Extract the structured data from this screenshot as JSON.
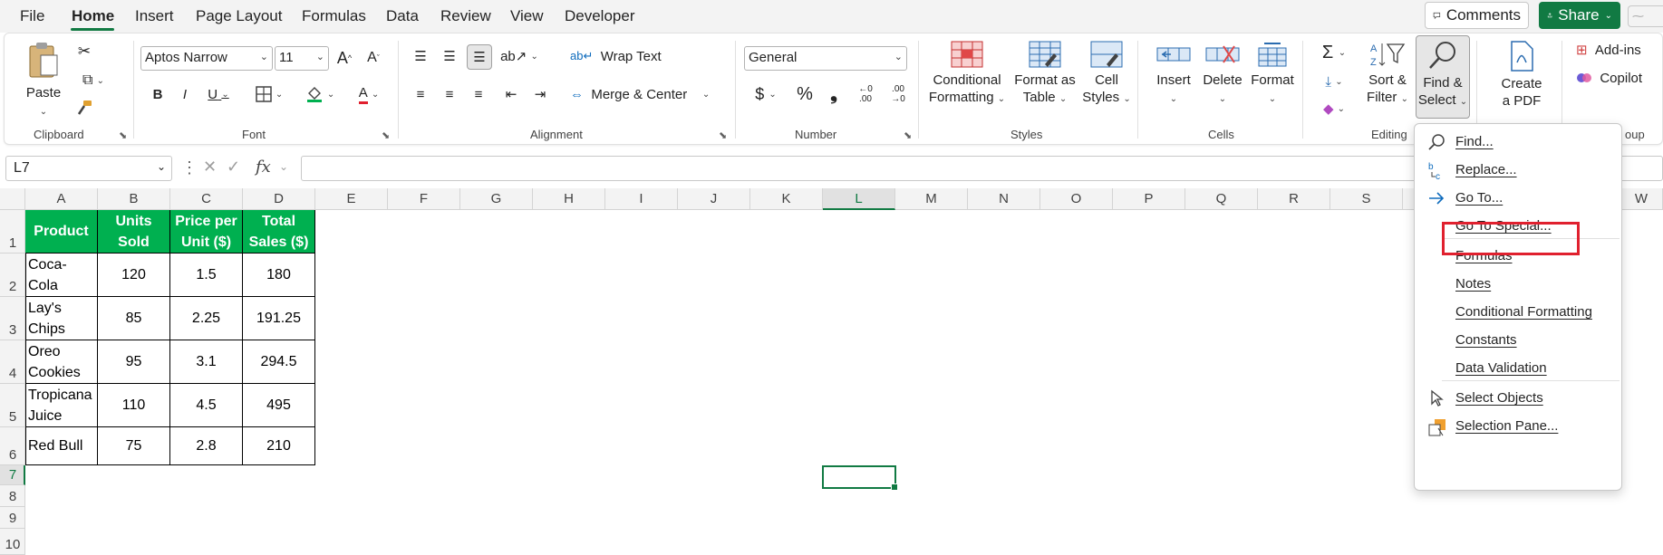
{
  "menu": {
    "tabs": [
      "File",
      "Home",
      "Insert",
      "Page Layout",
      "Formulas",
      "Data",
      "Review",
      "View",
      "Developer"
    ],
    "active_tab": "Home",
    "comments_label": "Comments",
    "share_label": "Share"
  },
  "ribbon": {
    "clipboard": {
      "paste_label": "Paste",
      "group_label": "Clipboard"
    },
    "font": {
      "font_name": "Aptos Narrow",
      "font_size": "11",
      "bold": "B",
      "italic": "I",
      "underline": "U",
      "grow": "A",
      "shrink": "A",
      "font_color_letter": "A",
      "group_label": "Font"
    },
    "alignment": {
      "wrap_text": "Wrap Text",
      "merge_center": "Merge & Center",
      "group_label": "Alignment"
    },
    "number": {
      "format": "General",
      "currency": "$",
      "percent": "%",
      "comma": "❟",
      "inc_decimal": "←0 .00",
      "dec_decimal": ".00 →0",
      "group_label": "Number"
    },
    "styles": {
      "conditional_formatting": [
        "Conditional",
        "Formatting"
      ],
      "format_as_table": [
        "Format as",
        "Table"
      ],
      "cell_styles": [
        "Cell",
        "Styles"
      ],
      "group_label": "Styles"
    },
    "cells": {
      "insert": "Insert",
      "delete": "Delete",
      "format": "Format",
      "group_label": "Cells"
    },
    "editing": {
      "sort_filter": [
        "Sort &",
        "Filter"
      ],
      "find_select": [
        "Find &",
        "Select"
      ],
      "group_label": "Editing"
    },
    "pdf": {
      "create_pdf": [
        "Create",
        "a PDF"
      ]
    },
    "addins": {
      "addins_label": "Add-ins",
      "copilot_label": "Copilot",
      "group_label_partial": "oup"
    }
  },
  "formula_bar": {
    "name_box": "L7",
    "fx": "fx",
    "formula": ""
  },
  "grid": {
    "columns": [
      "A",
      "B",
      "C",
      "D",
      "E",
      "F",
      "G",
      "H",
      "I",
      "J",
      "K",
      "L",
      "M",
      "N",
      "O",
      "P",
      "Q",
      "R",
      "S",
      "T",
      "W"
    ],
    "selected_column": "L",
    "rows": [
      "1",
      "2",
      "3",
      "4",
      "5",
      "6",
      "7",
      "8",
      "9",
      "10"
    ],
    "selected_row": "7"
  },
  "table": {
    "headers": [
      [
        "Product"
      ],
      [
        "Units",
        "Sold"
      ],
      [
        "Price per",
        "Unit ($)"
      ],
      [
        "Total",
        "Sales ($)"
      ]
    ],
    "rows": [
      [
        [
          "Coca-",
          "Cola"
        ],
        "120",
        "1.5",
        "180"
      ],
      [
        [
          "Lay's",
          "Chips"
        ],
        "85",
        "2.25",
        "191.25"
      ],
      [
        [
          "Oreo",
          "Cookies"
        ],
        "95",
        "3.1",
        "294.5"
      ],
      [
        [
          "Tropicana",
          "Juice"
        ],
        "110",
        "4.5",
        "495"
      ],
      [
        [
          "Red Bull"
        ],
        "75",
        "2.8",
        "210"
      ]
    ],
    "header_color": "#00b050"
  },
  "dropdown": {
    "items": [
      {
        "label": "Find...",
        "icon": "search-icon"
      },
      {
        "label": "Replace...",
        "icon": "replace-icon"
      },
      {
        "label": "Go To...",
        "icon": "arrow-right-icon"
      },
      {
        "label": "Go To Special...",
        "icon": "",
        "highlighted": true
      },
      {
        "label": "Formulas",
        "icon": ""
      },
      {
        "label": "Notes",
        "icon": ""
      },
      {
        "label": "Conditional Formatting",
        "icon": ""
      },
      {
        "label": "Constants",
        "icon": ""
      },
      {
        "label": "Data Validation",
        "icon": ""
      },
      {
        "label": "Select Objects",
        "icon": "cursor-icon"
      },
      {
        "label": "Selection Pane...",
        "icon": "selection-pane-icon"
      }
    ],
    "highlight_color": "#e0202e"
  },
  "colors": {
    "accent": "#117a43"
  }
}
